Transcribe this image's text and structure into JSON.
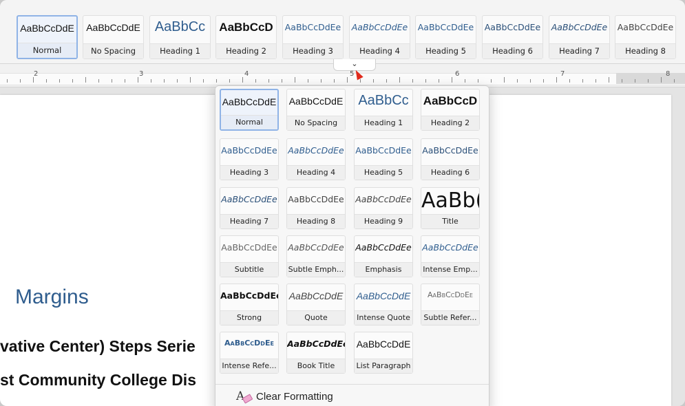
{
  "ribbon": {
    "styles": [
      {
        "sample": "AaBbCcDdE",
        "label": "Normal",
        "cls": "f-normal",
        "selected": true
      },
      {
        "sample": "AaBbCcDdE",
        "label": "No Spacing",
        "cls": "f-nospace"
      },
      {
        "sample": "AaBbCc",
        "label": "Heading 1",
        "cls": "f-h1"
      },
      {
        "sample": "AaBbCcD",
        "label": "Heading 2",
        "cls": "f-h2"
      },
      {
        "sample": "AaBbCcDdEe",
        "label": "Heading 3",
        "cls": "f-h3"
      },
      {
        "sample": "AaBbCcDdEe",
        "label": "Heading 4",
        "cls": "f-h4"
      },
      {
        "sample": "AaBbCcDdEe",
        "label": "Heading 5",
        "cls": "f-h5"
      },
      {
        "sample": "AaBbCcDdEe",
        "label": "Heading 6",
        "cls": "f-h6"
      },
      {
        "sample": "AaBbCcDdEe",
        "label": "Heading 7",
        "cls": "f-h7"
      },
      {
        "sample": "AaBbCcDdEe",
        "label": "Heading 8",
        "cls": "f-h8"
      }
    ],
    "collapse_glyph": "⌄"
  },
  "ruler": {
    "numbers": [
      "2",
      "3",
      "4",
      "5",
      "6",
      "7",
      "8"
    ]
  },
  "document": {
    "heading": "Margins",
    "line1": "vative Center) Steps Serie",
    "line2": "st Community College Dis"
  },
  "gallery": {
    "styles": [
      {
        "sample": "AaBbCcDdE",
        "label": "Normal",
        "cls": "f-normal",
        "selected": true
      },
      {
        "sample": "AaBbCcDdE",
        "label": "No Spacing",
        "cls": "f-nospace"
      },
      {
        "sample": "AaBbCc",
        "label": "Heading 1",
        "cls": "f-h1"
      },
      {
        "sample": "AaBbCcD",
        "label": "Heading 2",
        "cls": "f-h2"
      },
      {
        "sample": "AaBbCcDdEe",
        "label": "Heading 3",
        "cls": "f-h3"
      },
      {
        "sample": "AaBbCcDdEe",
        "label": "Heading 4",
        "cls": "f-h4"
      },
      {
        "sample": "AaBbCcDdEe",
        "label": "Heading 5",
        "cls": "f-h5"
      },
      {
        "sample": "AaBbCcDdEe",
        "label": "Heading 6",
        "cls": "f-h6"
      },
      {
        "sample": "AaBbCcDdEe",
        "label": "Heading 7",
        "cls": "f-h7"
      },
      {
        "sample": "AaBbCcDdEe",
        "label": "Heading 8",
        "cls": "f-h8"
      },
      {
        "sample": "AaBbCcDdEe",
        "label": "Heading 9",
        "cls": "f-h9"
      },
      {
        "sample": "AaBb(",
        "label": "Title",
        "cls": "f-title"
      },
      {
        "sample": "AaBbCcDdEe",
        "label": "Subtitle",
        "cls": "f-subtitle"
      },
      {
        "sample": "AaBbCcDdEe",
        "label": "Subtle Emph...",
        "cls": "f-subtle"
      },
      {
        "sample": "AaBbCcDdEe",
        "label": "Emphasis",
        "cls": "f-emph"
      },
      {
        "sample": "AaBbCcDdEe",
        "label": "Intense Emp...",
        "cls": "f-intemph"
      },
      {
        "sample": "AaBbCcDdEe",
        "label": "Strong",
        "cls": "f-strong"
      },
      {
        "sample": "AaBbCcDdE",
        "label": "Quote",
        "cls": "f-quote"
      },
      {
        "sample": "AaBbCcDdE",
        "label": "Intense Quote",
        "cls": "f-intquote"
      },
      {
        "sample": "AaBbCcDdEe",
        "label": "Subtle Refer...",
        "cls": "f-subref"
      },
      {
        "sample": "AaBbCcDdEe",
        "label": "Intense Refe...",
        "cls": "f-intref"
      },
      {
        "sample": "AaBbCcDdEe",
        "label": "Book Title",
        "cls": "f-book"
      },
      {
        "sample": "AaBbCcDdE",
        "label": "List Paragraph",
        "cls": "f-listpara"
      }
    ],
    "clear_formatting": "Clear Formatting",
    "clear_icon_glyph": "A"
  },
  "colors": {
    "accent": "#2f5d8e",
    "selection": "#8fb3e6",
    "cursor": "#e0291b"
  }
}
